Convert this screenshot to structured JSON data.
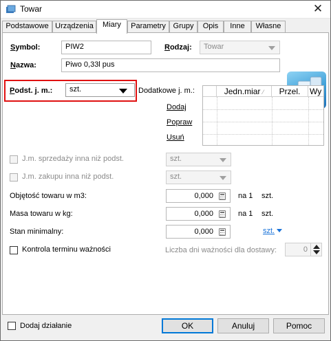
{
  "window": {
    "title": "Towar",
    "close_glyph": "✕"
  },
  "tabs": [
    {
      "label": "Podstawowe",
      "active": false
    },
    {
      "label": "Urządzenia",
      "active": false
    },
    {
      "label": "Miary",
      "active": true
    },
    {
      "label": "Parametry",
      "active": false
    },
    {
      "label": "Grupy",
      "active": false
    },
    {
      "label": "Opis",
      "active": false
    },
    {
      "label": "Inne",
      "active": false
    },
    {
      "label": "Własne",
      "active": false
    }
  ],
  "form": {
    "symbol_label": "Symbol:",
    "symbol_value": "PIW2",
    "rodzaj_label": "Rodzaj:",
    "rodzaj_value": "Towar",
    "nazwa_label": "Nazwa:",
    "nazwa_value": "Piwo 0,33l pus",
    "podst_jm_label": "Podst. j. m.:",
    "podst_jm_value": "szt.",
    "dodatkowe_jm_label": "Dodatkowe j. m.:",
    "grid_headers": [
      "Jedn.miar",
      "Przel.",
      "Wy"
    ],
    "grid_rows": [],
    "dodaj": "Dodaj",
    "popraw": "Popraw",
    "usun": "Usuń",
    "jm_sprzedazy_label": "J.m. sprzedaży inna niż podst.",
    "jm_sprzedazy_checked": false,
    "jm_sprzedazy_value": "szt.",
    "jm_zakupu_label": "J.m. zakupu inna niż podst.",
    "jm_zakupu_checked": false,
    "jm_zakupu_value": "szt.",
    "objetosc_label": "Objętość towaru w m3:",
    "objetosc_value": "0,000",
    "objetosc_per": "na 1",
    "objetosc_unit": "szt.",
    "masa_label": "Masa towaru w kg:",
    "masa_value": "0,000",
    "masa_per": "na 1",
    "masa_unit": "szt.",
    "stan_label": "Stan minimalny:",
    "stan_value": "0,000",
    "stan_unit": "szt.",
    "kontrola_label": "Kontrola terminu ważności",
    "kontrola_checked": false,
    "liczba_dni_label": "Liczba dni ważności dla dostawy:",
    "liczba_dni_value": "0"
  },
  "footer": {
    "dodaj_dzialanie_label": "Dodaj działanie",
    "dodaj_dzialanie_checked": false,
    "ok_label": "OK",
    "anuluj_label": "Anuluj",
    "pomoc_label": "Pomoc"
  },
  "colors": {
    "accent_blue": "#0078d7",
    "link_blue": "#1a73d9",
    "highlight_red": "#e01010"
  }
}
